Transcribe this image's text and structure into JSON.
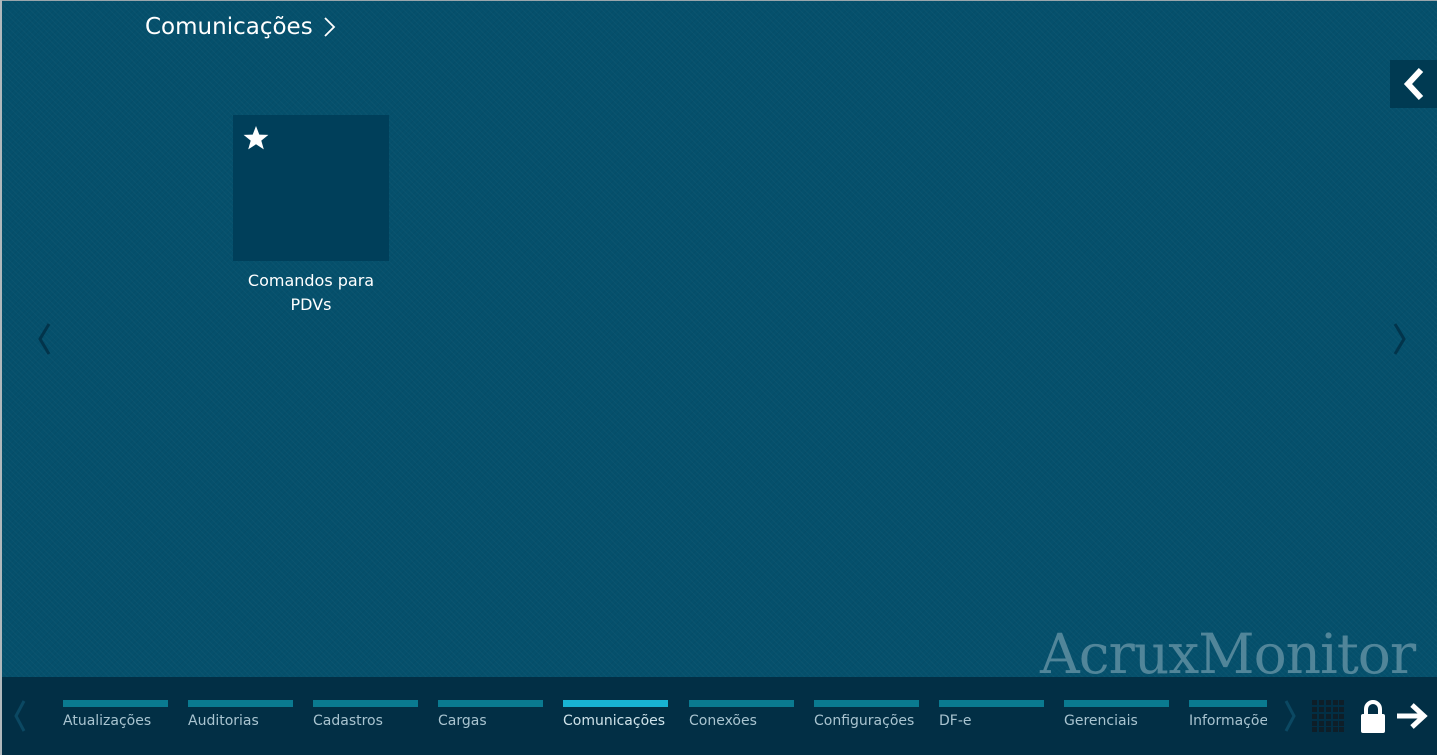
{
  "header": {
    "title": "Comunicações",
    "title_icon": "chevron-right-icon"
  },
  "tiles": [
    {
      "label": "Comandos para PDVs",
      "favorite_icon": "star-icon",
      "favorite": true
    }
  ],
  "pager": {
    "prev_icon": "chevron-left-icon",
    "next_icon": "chevron-right-icon"
  },
  "collapse": {
    "icon": "chevron-left-icon"
  },
  "watermark": "AcruxMonitor",
  "bottom_nav": {
    "tabs": [
      {
        "label": "Atualizações",
        "active": false
      },
      {
        "label": "Auditorias",
        "active": false
      },
      {
        "label": "Cadastros",
        "active": false
      },
      {
        "label": "Cargas",
        "active": false
      },
      {
        "label": "Comunicações",
        "active": true
      },
      {
        "label": "Conexões",
        "active": false
      },
      {
        "label": "Configurações",
        "active": false
      },
      {
        "label": "DF-e",
        "active": false
      },
      {
        "label": "Gerenciais",
        "active": false
      },
      {
        "label": "Informações",
        "active": false
      }
    ],
    "apps_icon": "grid-icon",
    "lock_icon": "lock-icon",
    "logout_icon": "arrow-right-icon"
  },
  "colors": {
    "background": "#05506c",
    "tile": "#003f5a",
    "bottom_bar": "#022f45",
    "tab_indicator": "#0a7a90",
    "tab_indicator_active": "#18b3d3"
  }
}
